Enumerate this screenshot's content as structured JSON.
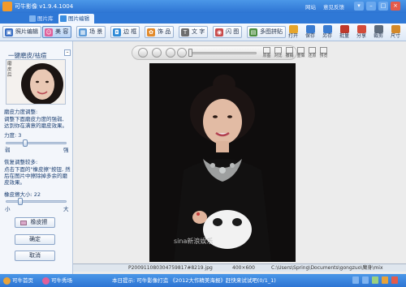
{
  "titlebar": {
    "title": "可牛影像 v1.9.4.1004",
    "links": [
      "网站",
      "意见反馈"
    ],
    "buttons": [
      "▾",
      "–",
      "□",
      "×"
    ]
  },
  "tabs": [
    {
      "label": "图片库",
      "active": false
    },
    {
      "label": "图片编辑",
      "active": true
    }
  ],
  "toolbar": {
    "items": [
      {
        "label": "照片编辑",
        "icon": "photo-edit-icon",
        "color": "#3a6fc4"
      },
      {
        "label": "美 容",
        "icon": "beauty-icon",
        "color": "#e0609a",
        "active": true
      },
      {
        "label": "场 景",
        "icon": "scene-icon",
        "color": "#5a9ad8"
      },
      {
        "label": "边 框",
        "icon": "frame-icon",
        "color": "#2f8ad6"
      },
      {
        "label": "饰 品",
        "icon": "decoration-icon",
        "color": "#e28a2b"
      },
      {
        "label": "文 字",
        "icon": "text-icon",
        "color": "#6d6d6d"
      },
      {
        "label": "闪 图",
        "icon": "flash-icon",
        "color": "#c94b4b"
      },
      {
        "label": "多图拼贴",
        "icon": "collage-icon",
        "color": "#4b8e3f"
      }
    ],
    "right_tools": [
      {
        "label": "打开",
        "icon": "open-icon",
        "color": "#e6a52b"
      },
      {
        "label": "保存",
        "icon": "save-icon",
        "color": "#3a7bd0"
      },
      {
        "label": "另存",
        "icon": "save-as-icon",
        "color": "#3a7bd0"
      },
      {
        "label": "批量",
        "icon": "batch-icon",
        "color": "#c0392b"
      },
      {
        "label": "分享",
        "icon": "share-icon",
        "color": "#d34b3a"
      },
      {
        "label": "裁剪",
        "icon": "crop-icon",
        "color": "#5d6a7a"
      },
      {
        "label": "尺寸",
        "icon": "resize-icon",
        "color": "#d4892a"
      }
    ]
  },
  "left_panel": {
    "title": "一键磨皮/祛痘",
    "face_tag": "磨皮后",
    "intensity_desc": "磨皮力度调整:",
    "intensity_hint": "调整下面磨皮力度的强弱, 达到你在满意的磨皮效果。",
    "intensity_label": "力度: 3",
    "intensity_value": 3,
    "intensity_max": 10,
    "range_min": "弱",
    "range_max": "强",
    "restore_desc": "恢复调整较多:",
    "restore_hint": "点击下面的\"橡皮擦\"按钮, 然后在图片中擦除掉多余的磨皮效果。",
    "brush_label": "橡皮擦大小: 22",
    "brush_value": 22,
    "brush_max": 100,
    "brush_min_label": "小",
    "brush_max_label": "大",
    "eraser_button": "橡皮擦",
    "ok_button": "确定",
    "cancel_button": "取消"
  },
  "canvas_controls": {
    "tools": [
      "原图",
      "对比",
      "撤销",
      "重做",
      "还原",
      "预览"
    ]
  },
  "photo": {
    "watermark": "sina新浪娱乐"
  },
  "statusbar": {
    "filename": "P200911080304759817#8219.jpg",
    "size": "400×600",
    "path": "C:\\Users\\Spring\\Documents\\gongzuo\\魔身\\mix"
  },
  "footer": {
    "home": "可牛首页",
    "show": "可牛秀场",
    "notice": "本日提示: 可牛影像打造 《2012大作精美海报》赶快来试试吧(0/1_1)"
  }
}
